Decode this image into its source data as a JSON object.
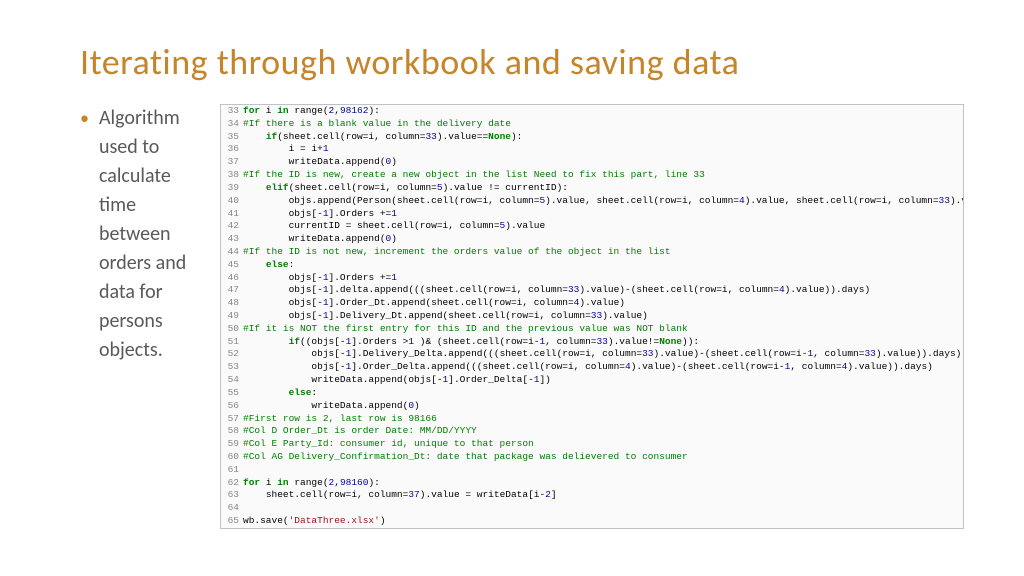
{
  "title": "Iterating through workbook and saving data",
  "bullet": "Algorithm used to calculate time between orders and data for persons objects.",
  "code_start_line": 33,
  "code_lines": [
    {
      "t": "code",
      "tokens": [
        {
          "c": "kw",
          "v": "for"
        },
        {
          "v": " i "
        },
        {
          "c": "kw",
          "v": "in"
        },
        {
          "v": " range("
        },
        {
          "c": "nm",
          "v": "2"
        },
        {
          "v": ","
        },
        {
          "c": "nm",
          "v": "98162"
        },
        {
          "v": "):"
        }
      ]
    },
    {
      "t": "cm",
      "v": "#If there is a blank value in the delivery date"
    },
    {
      "t": "code",
      "indent": 1,
      "tokens": [
        {
          "c": "kw",
          "v": "if"
        },
        {
          "v": "(sheet.cell(row=i, column="
        },
        {
          "c": "nm",
          "v": "33"
        },
        {
          "v": ").value=="
        },
        {
          "c": "bn",
          "v": "None"
        },
        {
          "v": "):"
        }
      ]
    },
    {
      "t": "code",
      "indent": 2,
      "tokens": [
        {
          "v": "i = i+"
        },
        {
          "c": "nm",
          "v": "1"
        }
      ]
    },
    {
      "t": "code",
      "indent": 2,
      "tokens": [
        {
          "v": "writeData.append("
        },
        {
          "c": "nm",
          "v": "0"
        },
        {
          "v": ")"
        }
      ]
    },
    {
      "t": "cm",
      "v": "#If the ID is new, create a new object in the list Need to fix this part, line 33"
    },
    {
      "t": "code",
      "indent": 1,
      "tokens": [
        {
          "c": "kw",
          "v": "elif"
        },
        {
          "v": "(sheet.cell(row=i, column="
        },
        {
          "c": "nm",
          "v": "5"
        },
        {
          "v": ").value != currentID):"
        }
      ]
    },
    {
      "t": "code",
      "indent": 2,
      "tokens": [
        {
          "v": "objs.append(Person(sheet.cell(row=i, column="
        },
        {
          "c": "nm",
          "v": "5"
        },
        {
          "v": ").value, sheet.cell(row=i, column="
        },
        {
          "c": "nm",
          "v": "4"
        },
        {
          "v": ").value, sheet.cell(row=i, column="
        },
        {
          "c": "nm",
          "v": "33"
        },
        {
          "v": ").value))"
        }
      ]
    },
    {
      "t": "code",
      "indent": 2,
      "tokens": [
        {
          "v": "objs[-"
        },
        {
          "c": "nm",
          "v": "1"
        },
        {
          "v": "].Orders +="
        },
        {
          "c": "nm",
          "v": "1"
        }
      ]
    },
    {
      "t": "code",
      "indent": 2,
      "tokens": [
        {
          "v": "currentID = sheet.cell(row=i, column="
        },
        {
          "c": "nm",
          "v": "5"
        },
        {
          "v": ").value"
        }
      ]
    },
    {
      "t": "code",
      "indent": 2,
      "tokens": [
        {
          "v": "writeData.append("
        },
        {
          "c": "nm",
          "v": "0"
        },
        {
          "v": ")"
        }
      ]
    },
    {
      "t": "cm",
      "v": "#If the ID is not new, increment the orders value of the object in the list"
    },
    {
      "t": "code",
      "indent": 1,
      "tokens": [
        {
          "c": "kw",
          "v": "else"
        },
        {
          "v": ":"
        }
      ]
    },
    {
      "t": "code",
      "indent": 2,
      "tokens": [
        {
          "v": "objs[-"
        },
        {
          "c": "nm",
          "v": "1"
        },
        {
          "v": "].Orders +="
        },
        {
          "c": "nm",
          "v": "1"
        }
      ]
    },
    {
      "t": "code",
      "indent": 2,
      "tokens": [
        {
          "v": "objs[-"
        },
        {
          "c": "nm",
          "v": "1"
        },
        {
          "v": "].delta.append(((sheet.cell(row=i, column="
        },
        {
          "c": "nm",
          "v": "33"
        },
        {
          "v": ").value)-(sheet.cell(row=i, column="
        },
        {
          "c": "nm",
          "v": "4"
        },
        {
          "v": ").value)).days)"
        }
      ]
    },
    {
      "t": "code",
      "indent": 2,
      "tokens": [
        {
          "v": "objs[-"
        },
        {
          "c": "nm",
          "v": "1"
        },
        {
          "v": "].Order_Dt.append(sheet.cell(row=i, column="
        },
        {
          "c": "nm",
          "v": "4"
        },
        {
          "v": ").value)"
        }
      ]
    },
    {
      "t": "code",
      "indent": 2,
      "tokens": [
        {
          "v": "objs[-"
        },
        {
          "c": "nm",
          "v": "1"
        },
        {
          "v": "].Delivery_Dt.append(sheet.cell(row=i, column="
        },
        {
          "c": "nm",
          "v": "33"
        },
        {
          "v": ").value)"
        }
      ]
    },
    {
      "t": "cm",
      "v": "#If it is NOT the first entry for this ID and the previous value was NOT blank"
    },
    {
      "t": "code",
      "indent": 2,
      "tokens": [
        {
          "c": "kw",
          "v": "if"
        },
        {
          "v": "((objs[-"
        },
        {
          "c": "nm",
          "v": "1"
        },
        {
          "v": "].Orders >"
        },
        {
          "c": "nm",
          "v": "1"
        },
        {
          "v": " )& (sheet.cell(row=i-"
        },
        {
          "c": "nm",
          "v": "1"
        },
        {
          "v": ", column="
        },
        {
          "c": "nm",
          "v": "33"
        },
        {
          "v": ").value!="
        },
        {
          "c": "bn",
          "v": "None"
        },
        {
          "v": ")):"
        }
      ]
    },
    {
      "t": "code",
      "indent": 3,
      "tokens": [
        {
          "v": "objs[-"
        },
        {
          "c": "nm",
          "v": "1"
        },
        {
          "v": "].Delivery_Delta.append(((sheet.cell(row=i, column="
        },
        {
          "c": "nm",
          "v": "33"
        },
        {
          "v": ").value)-(sheet.cell(row=i-"
        },
        {
          "c": "nm",
          "v": "1"
        },
        {
          "v": ", column="
        },
        {
          "c": "nm",
          "v": "33"
        },
        {
          "v": ").value)).days)"
        }
      ]
    },
    {
      "t": "code",
      "indent": 3,
      "tokens": [
        {
          "v": "objs[-"
        },
        {
          "c": "nm",
          "v": "1"
        },
        {
          "v": "].Order_Delta.append(((sheet.cell(row=i, column="
        },
        {
          "c": "nm",
          "v": "4"
        },
        {
          "v": ").value)-(sheet.cell(row=i-"
        },
        {
          "c": "nm",
          "v": "1"
        },
        {
          "v": ", column="
        },
        {
          "c": "nm",
          "v": "4"
        },
        {
          "v": ").value)).days)"
        }
      ]
    },
    {
      "t": "code",
      "indent": 3,
      "tokens": [
        {
          "v": "writeData.append(objs[-"
        },
        {
          "c": "nm",
          "v": "1"
        },
        {
          "v": "].Order_Delta[-"
        },
        {
          "c": "nm",
          "v": "1"
        },
        {
          "v": "])"
        }
      ]
    },
    {
      "t": "code",
      "indent": 2,
      "tokens": [
        {
          "c": "kw",
          "v": "else"
        },
        {
          "v": ":"
        }
      ]
    },
    {
      "t": "code",
      "indent": 3,
      "tokens": [
        {
          "v": "writeData.append("
        },
        {
          "c": "nm",
          "v": "0"
        },
        {
          "v": ")"
        }
      ]
    },
    {
      "t": "cm",
      "v": "#First row is 2, last row is 98166"
    },
    {
      "t": "cm",
      "v": "#Col D Order_Dt is order Date: MM/DD/YYYY"
    },
    {
      "t": "cm",
      "v": "#Col E Party_Id: consumer id, unique to that person"
    },
    {
      "t": "cm",
      "v": "#Col AG Delivery_Confirmation_Dt: date that package was delievered to consumer"
    },
    {
      "t": "blank",
      "v": ""
    },
    {
      "t": "code",
      "tokens": [
        {
          "c": "kw",
          "v": "for"
        },
        {
          "v": " i "
        },
        {
          "c": "kw",
          "v": "in"
        },
        {
          "v": " range("
        },
        {
          "c": "nm",
          "v": "2"
        },
        {
          "v": ","
        },
        {
          "c": "nm",
          "v": "98160"
        },
        {
          "v": "):"
        }
      ]
    },
    {
      "t": "code",
      "indent": 1,
      "tokens": [
        {
          "v": "sheet.cell(row=i, column="
        },
        {
          "c": "nm",
          "v": "37"
        },
        {
          "v": ").value = writeData[i-"
        },
        {
          "c": "nm",
          "v": "2"
        },
        {
          "v": "]"
        }
      ]
    },
    {
      "t": "blank",
      "v": ""
    },
    {
      "t": "code",
      "tokens": [
        {
          "v": "wb.save("
        },
        {
          "c": "st",
          "v": "'DataThree.xlsx'"
        },
        {
          "v": ")"
        }
      ]
    }
  ]
}
